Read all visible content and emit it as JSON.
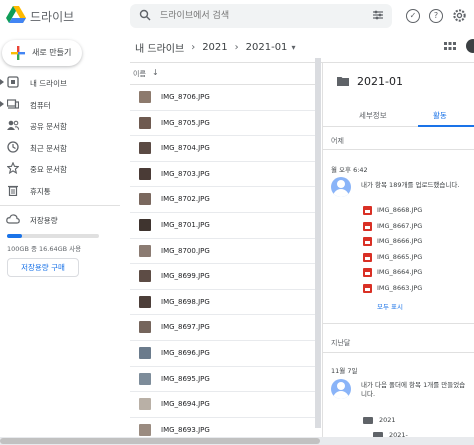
{
  "header": {
    "brand": "드라이브",
    "search_placeholder": "드라이브에서 검색",
    "icons": [
      "search-icon",
      "filter-icon",
      "offline-icon",
      "help-icon",
      "settings-icon"
    ]
  },
  "sidebar": {
    "new_label": "새로 만들기",
    "items": [
      {
        "label": "내 드라이브",
        "icon": "my-drive-icon"
      },
      {
        "label": "컴퓨터",
        "icon": "computer-icon"
      },
      {
        "label": "공유 문서함",
        "icon": "shared-icon"
      },
      {
        "label": "최근 문서함",
        "icon": "recent-icon"
      },
      {
        "label": "중요 문서함",
        "icon": "star-icon"
      },
      {
        "label": "휴지통",
        "icon": "trash-icon"
      }
    ],
    "storage_label": "저장용량",
    "storage_used_fraction": 0.1664,
    "storage_text": "100GB 중 16.64GB 사용",
    "buy_label": "저장용량 구매"
  },
  "breadcrumb": [
    "내 드라이브",
    "2021",
    "2021-01"
  ],
  "file_list": {
    "header_label": "이름",
    "sort_icon": "↓",
    "files": [
      {
        "name": "IMG_8706.JPG",
        "thumb": "#8d7a6d"
      },
      {
        "name": "IMG_8705.JPG",
        "thumb": "#6e5a50"
      },
      {
        "name": "IMG_8704.JPG",
        "thumb": "#5b4a44"
      },
      {
        "name": "IMG_8703.JPG",
        "thumb": "#4a3b36"
      },
      {
        "name": "IMG_8702.JPG",
        "thumb": "#7a685e"
      },
      {
        "name": "IMG_8701.JPG",
        "thumb": "#3f342f"
      },
      {
        "name": "IMG_8700.JPG",
        "thumb": "#8b7b72"
      },
      {
        "name": "IMG_8699.JPG",
        "thumb": "#5d4c45"
      },
      {
        "name": "IMG_8698.JPG",
        "thumb": "#4c3e39"
      },
      {
        "name": "IMG_8697.JPG",
        "thumb": "#75655c"
      },
      {
        "name": "IMG_8696.JPG",
        "thumb": "#6b7b8c"
      },
      {
        "name": "IMG_8695.JPG",
        "thumb": "#7d8c9a"
      },
      {
        "name": "IMG_8694.JPG",
        "thumb": "#b9b0a6"
      },
      {
        "name": "IMG_8693.JPG",
        "thumb": "#9a8b80"
      }
    ]
  },
  "panel": {
    "title": "2021-01",
    "tabs": [
      "세부정보",
      "활동"
    ],
    "section1": "어제",
    "time1": "월 오후 6:42",
    "activity1": "내가 항목 189개를 업로드했습니다.",
    "uploaded": [
      "IMG_8668.JPG",
      "IMG_8667.JPG",
      "IMG_8666.JPG",
      "IMG_8665.JPG",
      "IMG_8664.JPG",
      "IMG_8663.JPG"
    ],
    "more_label": "모두 표시",
    "section2": "지난달",
    "time2": "11월 7일",
    "activity2": "내가 다음 폴더에 항목 1개를 만들었습니다.",
    "folders": [
      "2021",
      "2021-01"
    ]
  }
}
